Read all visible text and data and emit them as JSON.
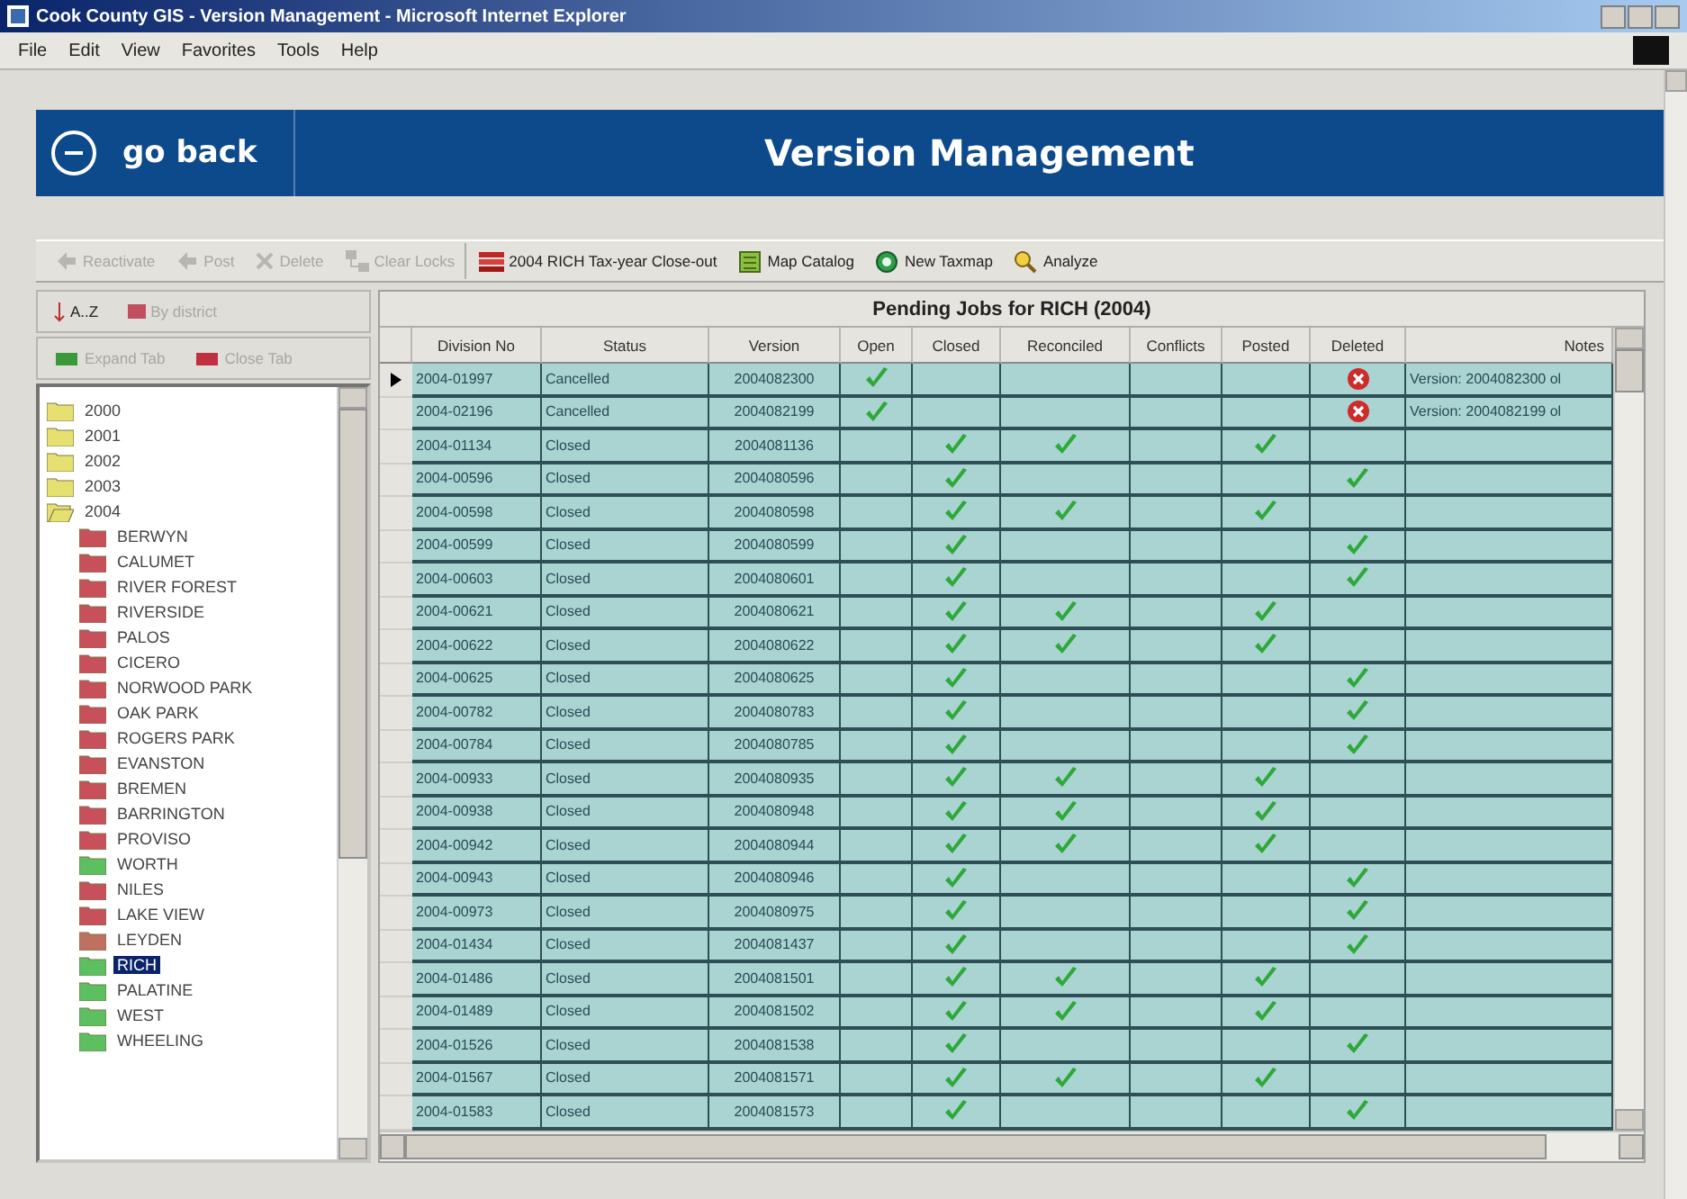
{
  "window": {
    "title": "Cook County GIS - Version Management - Microsoft Internet Explorer"
  },
  "menu": [
    "File",
    "Edit",
    "View",
    "Favorites",
    "Tools",
    "Help"
  ],
  "header": {
    "back_label": "go back",
    "title": "Version Management"
  },
  "toolbar": [
    {
      "label": "Reactivate",
      "disabled": true
    },
    {
      "label": "Post",
      "disabled": true
    },
    {
      "label": "Delete",
      "disabled": true
    },
    {
      "label": "Clear Locks",
      "disabled": true
    },
    {
      "label": "2004 RICH Tax-year Close-out",
      "disabled": false
    },
    {
      "label": "Map Catalog",
      "disabled": false
    },
    {
      "label": "New Taxmap",
      "disabled": false
    },
    {
      "label": "Analyze",
      "disabled": false
    }
  ],
  "sidebar": {
    "sort_buttons": [
      {
        "label": "A..Z",
        "disabled": false
      },
      {
        "label": "By district",
        "disabled": true
      }
    ],
    "tree_buttons": [
      {
        "label": "Expand Tab",
        "disabled": true
      },
      {
        "label": "Close Tab",
        "disabled": true
      }
    ],
    "tree": [
      {
        "label": "2000",
        "color": "#e6e070",
        "expanded": false,
        "selected": false
      },
      {
        "label": "2001",
        "color": "#e6e070",
        "expanded": false,
        "selected": false
      },
      {
        "label": "2002",
        "color": "#e6e070",
        "expanded": false,
        "selected": false
      },
      {
        "label": "2003",
        "color": "#e6e070",
        "expanded": false,
        "selected": false
      },
      {
        "label": "2004",
        "color": "#e6e070",
        "expanded": true,
        "selected": false,
        "children": [
          {
            "label": "BERWYN",
            "color": "#c8505a",
            "selected": false
          },
          {
            "label": "CALUMET",
            "color": "#c8505a",
            "selected": false
          },
          {
            "label": "RIVER FOREST",
            "color": "#c8505a",
            "selected": false
          },
          {
            "label": "RIVERSIDE",
            "color": "#c8505a",
            "selected": false
          },
          {
            "label": "PALOS",
            "color": "#c8505a",
            "selected": false
          },
          {
            "label": "CICERO",
            "color": "#c8505a",
            "selected": false
          },
          {
            "label": "NORWOOD PARK",
            "color": "#c8505a",
            "selected": false
          },
          {
            "label": "OAK PARK",
            "color": "#c8505a",
            "selected": false
          },
          {
            "label": "ROGERS PARK",
            "color": "#c8505a",
            "selected": false
          },
          {
            "label": "EVANSTON",
            "color": "#c8505a",
            "selected": false
          },
          {
            "label": "BREMEN",
            "color": "#c8505a",
            "selected": false
          },
          {
            "label": "BARRINGTON",
            "color": "#c8505a",
            "selected": false
          },
          {
            "label": "PROVISO",
            "color": "#c8505a",
            "selected": false
          },
          {
            "label": "WORTH",
            "color": "#5cc060",
            "selected": false
          },
          {
            "label": "NILES",
            "color": "#c8505a",
            "selected": false
          },
          {
            "label": "LAKE VIEW",
            "color": "#c8505a",
            "selected": false
          },
          {
            "label": "LEYDEN",
            "color": "#c07060",
            "selected": false
          },
          {
            "label": "RICH",
            "color": "#5cc060",
            "selected": true
          },
          {
            "label": "PALATINE",
            "color": "#5cc060",
            "selected": false
          },
          {
            "label": "WEST",
            "color": "#5cc060",
            "selected": false
          },
          {
            "label": "WHEELING",
            "color": "#5cc060",
            "selected": false
          }
        ]
      }
    ]
  },
  "table": {
    "caption": "Pending Jobs for RICH (2004)",
    "columns": [
      "Division No",
      "Status",
      "Version",
      "Open",
      "Closed",
      "Reconciled",
      "Conflicts",
      "Posted",
      "Deleted",
      "Notes"
    ],
    "rows": [
      {
        "selected": true,
        "division": "2004-01997",
        "status": "Cancelled",
        "version": "2004082300",
        "open": true,
        "closed": false,
        "reconciled": false,
        "conflicts": false,
        "posted": false,
        "deleted": true,
        "deletion_failed": true,
        "notes": "Version: 2004082300 ol"
      },
      {
        "selected": false,
        "division": "2004-02196",
        "status": "Cancelled",
        "version": "2004082199",
        "open": true,
        "closed": false,
        "reconciled": false,
        "conflicts": false,
        "posted": false,
        "deleted": true,
        "deletion_failed": true,
        "notes": "Version: 2004082199 ol"
      },
      {
        "selected": false,
        "division": "2004-01134",
        "status": "Closed",
        "version": "2004081136",
        "open": false,
        "closed": true,
        "reconciled": true,
        "conflicts": false,
        "posted": true,
        "deleted": false,
        "deletion_failed": false
      },
      {
        "selected": false,
        "division": "2004-00596",
        "status": "Closed",
        "version": "2004080596",
        "open": false,
        "closed": true,
        "reconciled": false,
        "conflicts": false,
        "posted": false,
        "deleted": true,
        "deletion_failed": false
      },
      {
        "selected": false,
        "division": "2004-00598",
        "status": "Closed",
        "version": "2004080598",
        "open": false,
        "closed": true,
        "reconciled": true,
        "conflicts": false,
        "posted": true,
        "deleted": false,
        "deletion_failed": false
      },
      {
        "selected": false,
        "division": "2004-00599",
        "status": "Closed",
        "version": "2004080599",
        "open": false,
        "closed": true,
        "reconciled": false,
        "conflicts": false,
        "posted": false,
        "deleted": true,
        "deletion_failed": false
      },
      {
        "selected": false,
        "division": "2004-00603",
        "status": "Closed",
        "version": "2004080601",
        "open": false,
        "closed": true,
        "reconciled": false,
        "conflicts": false,
        "posted": false,
        "deleted": true,
        "deletion_failed": false
      },
      {
        "selected": false,
        "division": "2004-00621",
        "status": "Closed",
        "version": "2004080621",
        "open": false,
        "closed": true,
        "reconciled": true,
        "conflicts": false,
        "posted": true,
        "deleted": false,
        "deletion_failed": false
      },
      {
        "selected": false,
        "division": "2004-00622",
        "status": "Closed",
        "version": "2004080622",
        "open": false,
        "closed": true,
        "reconciled": true,
        "conflicts": false,
        "posted": true,
        "deleted": false,
        "deletion_failed": false
      },
      {
        "selected": false,
        "division": "2004-00625",
        "status": "Closed",
        "version": "2004080625",
        "open": false,
        "closed": true,
        "reconciled": false,
        "conflicts": false,
        "posted": false,
        "deleted": true,
        "deletion_failed": false
      },
      {
        "selected": false,
        "division": "2004-00782",
        "status": "Closed",
        "version": "2004080783",
        "open": false,
        "closed": true,
        "reconciled": false,
        "conflicts": false,
        "posted": false,
        "deleted": true,
        "deletion_failed": false
      },
      {
        "selected": false,
        "division": "2004-00784",
        "status": "Closed",
        "version": "2004080785",
        "open": false,
        "closed": true,
        "reconciled": false,
        "conflicts": false,
        "posted": false,
        "deleted": true,
        "deletion_failed": false
      },
      {
        "selected": false,
        "division": "2004-00933",
        "status": "Closed",
        "version": "2004080935",
        "open": false,
        "closed": true,
        "reconciled": true,
        "conflicts": false,
        "posted": true,
        "deleted": false,
        "deletion_failed": false
      },
      {
        "selected": false,
        "division": "2004-00938",
        "status": "Closed",
        "version": "2004080948",
        "open": false,
        "closed": true,
        "reconciled": true,
        "conflicts": false,
        "posted": true,
        "deleted": false,
        "deletion_failed": false
      },
      {
        "selected": false,
        "division": "2004-00942",
        "status": "Closed",
        "version": "2004080944",
        "open": false,
        "closed": true,
        "reconciled": true,
        "conflicts": false,
        "posted": true,
        "deleted": false,
        "deletion_failed": false
      },
      {
        "selected": false,
        "division": "2004-00943",
        "status": "Closed",
        "version": "2004080946",
        "open": false,
        "closed": true,
        "reconciled": false,
        "conflicts": false,
        "posted": false,
        "deleted": true,
        "deletion_failed": false
      },
      {
        "selected": false,
        "division": "2004-00973",
        "status": "Closed",
        "version": "2004080975",
        "open": false,
        "closed": true,
        "reconciled": false,
        "conflicts": false,
        "posted": false,
        "deleted": true,
        "deletion_failed": false
      },
      {
        "selected": false,
        "division": "2004-01434",
        "status": "Closed",
        "version": "2004081437",
        "open": false,
        "closed": true,
        "reconciled": false,
        "conflicts": false,
        "posted": false,
        "deleted": true,
        "deletion_failed": false
      },
      {
        "selected": false,
        "division": "2004-01486",
        "status": "Closed",
        "version": "2004081501",
        "open": false,
        "closed": true,
        "reconciled": true,
        "conflicts": false,
        "posted": true,
        "deleted": false,
        "deletion_failed": false
      },
      {
        "selected": false,
        "division": "2004-01489",
        "status": "Closed",
        "version": "2004081502",
        "open": false,
        "closed": true,
        "reconciled": true,
        "conflicts": false,
        "posted": true,
        "deleted": false,
        "deletion_failed": false
      },
      {
        "selected": false,
        "division": "2004-01526",
        "status": "Closed",
        "version": "2004081538",
        "open": false,
        "closed": true,
        "reconciled": false,
        "conflicts": false,
        "posted": false,
        "deleted": true,
        "deletion_failed": false
      },
      {
        "selected": false,
        "division": "2004-01567",
        "status": "Closed",
        "version": "2004081571",
        "open": false,
        "closed": true,
        "reconciled": true,
        "conflicts": false,
        "posted": true,
        "deleted": false,
        "deletion_failed": false
      },
      {
        "selected": false,
        "division": "2004-01583",
        "status": "Closed",
        "version": "2004081573",
        "open": false,
        "closed": true,
        "reconciled": false,
        "conflicts": false,
        "posted": false,
        "deleted": true,
        "deletion_failed": false
      }
    ]
  }
}
